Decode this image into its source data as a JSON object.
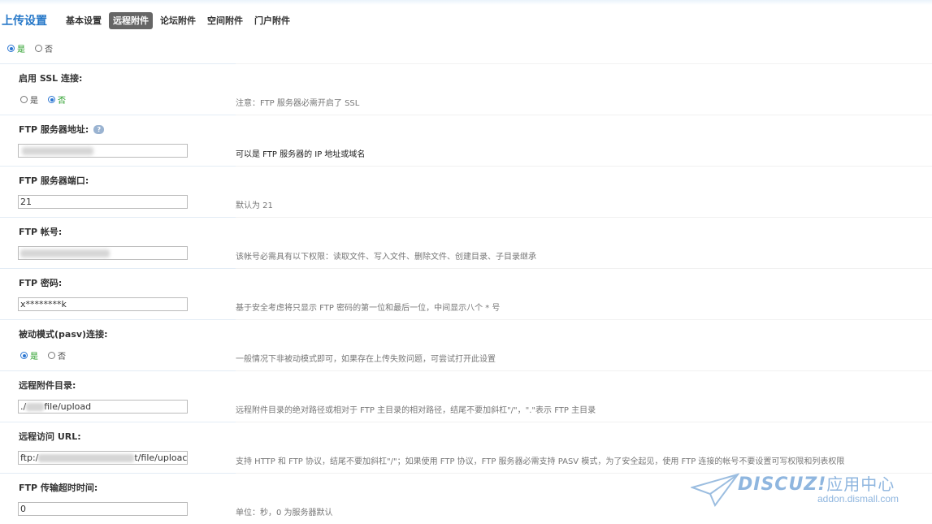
{
  "header": {
    "title": "上传设置",
    "tabs": [
      {
        "label": "基本设置",
        "active": false
      },
      {
        "label": "远程附件",
        "active": true
      },
      {
        "label": "论坛附件",
        "active": false
      },
      {
        "label": "空间附件",
        "active": false
      },
      {
        "label": "门户附件",
        "active": false
      }
    ]
  },
  "top_radio": {
    "yes": "是",
    "no": "否",
    "selected": "yes"
  },
  "settings": {
    "ssl": {
      "label": "启用 SSL 连接:",
      "yes": "是",
      "no": "否",
      "selected": "no",
      "note": "注意：FTP 服务器必需开启了 SSL"
    },
    "host": {
      "label": "FTP 服务器地址:",
      "value": "",
      "note": "可以是 FTP 服务器的 IP 地址或域名"
    },
    "port": {
      "label": "FTP 服务器端口:",
      "value": "21",
      "note": "默认为 21"
    },
    "account": {
      "label": "FTP 帐号:",
      "value": "",
      "note": "该帐号必需具有以下权限：读取文件、写入文件、删除文件、创建目录、子目录继承"
    },
    "password": {
      "label": "FTP 密码:",
      "value": "x********k",
      "note": "基于安全考虑将只显示 FTP 密码的第一位和最后一位，中间显示八个 * 号"
    },
    "pasv": {
      "label": "被动模式(pasv)连接:",
      "yes": "是",
      "no": "否",
      "selected": "yes",
      "note": "一般情况下非被动模式即可，如果存在上传失败问题，可尝试打开此设置"
    },
    "dir": {
      "label": "远程附件目录:",
      "value_prefix": "./",
      "value_suffix": "file/upload",
      "note": "远程附件目录的绝对路径或相对于 FTP 主目录的相对路径，结尾不要加斜杠\"/\"，\".\"表示 FTP 主目录"
    },
    "url": {
      "label": "远程访问 URL:",
      "value_prefix": "ftp:/",
      "value_suffix": "t/file/uploac",
      "note": "支持 HTTP 和 FTP 协议，结尾不要加斜杠\"/\"；如果使用 FTP 协议，FTP 服务器必需支持 PASV 模式，为了安全起见，使用 FTP 连接的帐号不要设置可写权限和列表权限"
    },
    "timeout": {
      "label": "FTP 传输超时时间:",
      "value": "0",
      "note": "单位：秒，0 为服务器默认"
    }
  },
  "watermark": {
    "brand": "DISCUZ!",
    "brand_cn": "应用中心",
    "url": "addon.dismall.com"
  },
  "colors": {
    "accent": "#2577c8",
    "active_tab": "#666666",
    "radio_on": "#2b76d2",
    "yes_text": "#1f9a1f"
  }
}
